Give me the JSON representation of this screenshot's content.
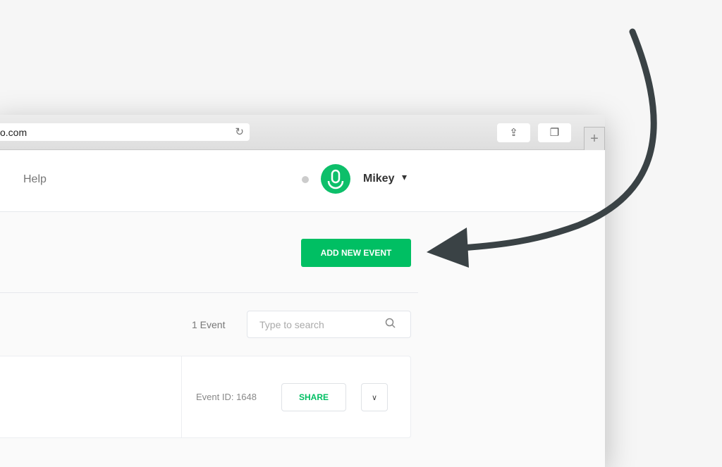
{
  "browser": {
    "url": "o.com"
  },
  "header": {
    "nav_help": "Help",
    "user_name": "Mikey"
  },
  "main": {
    "add_button": "ADD NEW EVENT",
    "event_count": "1 Event",
    "search_placeholder": "Type to search"
  },
  "event": {
    "id_label": "Event ID: 1648",
    "share_label": "SHARE"
  },
  "colors": {
    "brand": "#00bf63",
    "arrow": "#3a4245"
  }
}
